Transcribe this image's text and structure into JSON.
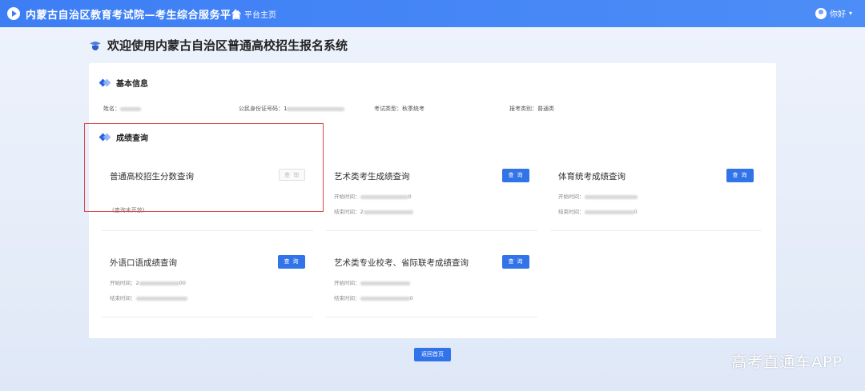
{
  "header": {
    "title": "内蒙古自治区教育考试院—考生综合服务平台",
    "home_label": "平台主页",
    "greeting": "你好",
    "caret": "▾"
  },
  "page": {
    "title": "欢迎使用内蒙古自治区普通高校招生报名系统"
  },
  "basic_info": {
    "section_title": "基本信息",
    "fields": [
      {
        "label": "姓名：",
        "value": ""
      },
      {
        "label": "公民身份证号码：",
        "value": "1"
      },
      {
        "label": "考试类型：",
        "value": "秋季统考"
      },
      {
        "label": "报考类别：",
        "value": "普通类"
      }
    ]
  },
  "score_query": {
    "section_title": "成绩查询",
    "start_label": "开始时间：",
    "end_label": "结束时间：",
    "query_label": "查 询",
    "cards": [
      {
        "name": "普通高校招生分数查询",
        "note": "(查询未开放)",
        "start": "",
        "end": ""
      },
      {
        "name": "艺术类考生成绩查询",
        "start": "0",
        "end": "2"
      },
      {
        "name": "体育统考成绩查询",
        "start": "",
        "end": "0"
      },
      {
        "name": "外语口语成绩查询",
        "start": "2",
        "end": "00"
      },
      {
        "name": "艺术类专业校考、省际联考成绩查询",
        "start": "",
        "end": "0"
      }
    ]
  },
  "footer": {
    "back_label": "返回首页"
  },
  "watermark": "高考直通车APP"
}
